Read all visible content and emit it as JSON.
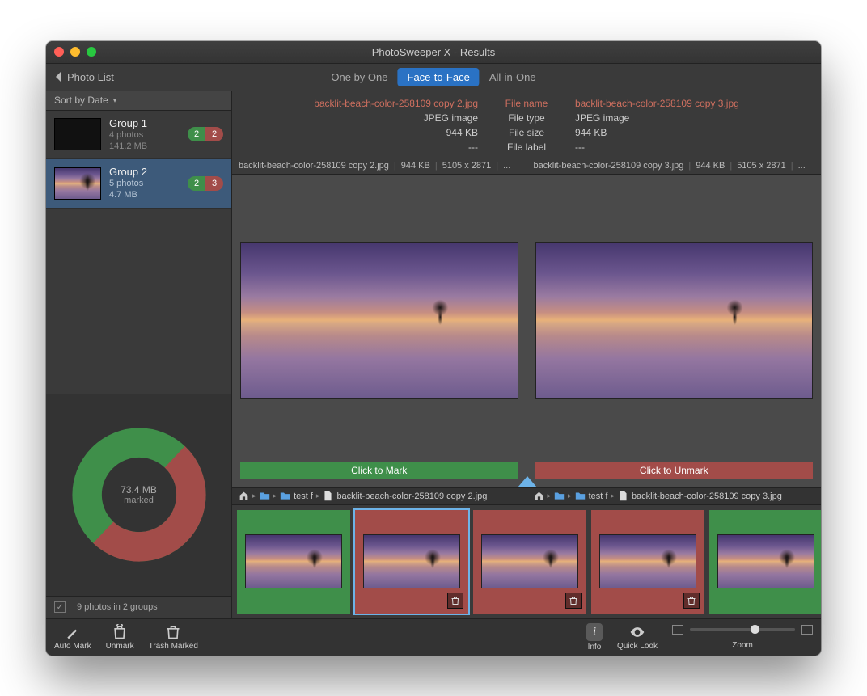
{
  "title": "PhotoSweeper X - Results",
  "toolbar": {
    "back": "Photo List",
    "tabs": [
      "One by One",
      "Face-to-Face",
      "All-in-One"
    ],
    "active_tab": 1
  },
  "sidebar": {
    "sort": "Sort by Date",
    "groups": [
      {
        "name": "Group 1",
        "count": "4 photos",
        "size": "141.2 MB",
        "green": "2",
        "red": "2",
        "selected": false
      },
      {
        "name": "Group 2",
        "count": "5 photos",
        "size": "4.7 MB",
        "green": "2",
        "red": "3",
        "selected": true
      }
    ],
    "donut": {
      "line1": "73.4 MB",
      "line2": "marked"
    },
    "status": "9 photos in 2 groups"
  },
  "meta": {
    "labels": [
      "File name",
      "File type",
      "File size",
      "File label"
    ],
    "left": {
      "fname": "backlit-beach-color-258109 copy 2.jpg",
      "type": "JPEG image",
      "size": "944 KB",
      "label": "---"
    },
    "right": {
      "fname": "backlit-beach-color-258109 copy 3.jpg",
      "type": "JPEG image",
      "size": "944 KB",
      "label": "---"
    }
  },
  "panes": {
    "left": {
      "head_name": "backlit-beach-color-258109 copy 2.jpg",
      "head_size": "944 KB",
      "head_dim": "5105 x 2871",
      "head_extra": "...",
      "markbar": "Click to Mark"
    },
    "right": {
      "head_name": "backlit-beach-color-258109 copy 3.jpg",
      "head_size": "944 KB",
      "head_dim": "5105 x 2871",
      "head_extra": "...",
      "markbar": "Click to Unmark"
    }
  },
  "crumbs": {
    "left": {
      "folder": "test f",
      "file": "backlit-beach-color-258109 copy 2.jpg"
    },
    "right": {
      "folder": "test f",
      "file": "backlit-beach-color-258109 copy 3.jpg"
    }
  },
  "strip": [
    {
      "state": "green",
      "trash": false,
      "selected": false
    },
    {
      "state": "red",
      "trash": true,
      "selected": true
    },
    {
      "state": "red",
      "trash": true,
      "selected": false
    },
    {
      "state": "red",
      "trash": true,
      "selected": false
    },
    {
      "state": "green",
      "trash": false,
      "selected": false
    }
  ],
  "bottombar": {
    "automark": "Auto Mark",
    "unmark": "Unmark",
    "trash": "Trash Marked",
    "info": "Info",
    "quicklook": "Quick Look",
    "zoom": "Zoom"
  }
}
